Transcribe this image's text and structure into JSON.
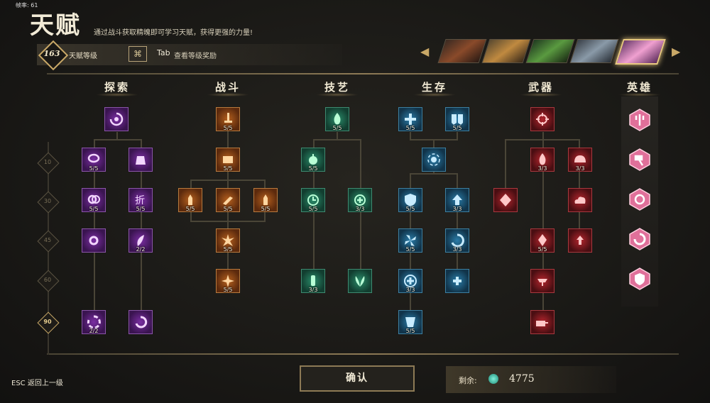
{
  "fps_label": "帧率: 61",
  "page": {
    "title": "天赋",
    "subtitle": "通过战斗获取精魄即可学习天赋，获得更强的力量!"
  },
  "header": {
    "level_value": "163",
    "level_label": "天赋等级",
    "tab_key": "Tab",
    "tab_label": "查看等级奖励"
  },
  "heroes": [
    "hero-1",
    "hero-2",
    "hero-3",
    "hero-4",
    "hero-5"
  ],
  "categories": [
    "探索",
    "战斗",
    "技艺",
    "生存",
    "武器",
    "英雄"
  ],
  "gates": [
    "10",
    "30",
    "45",
    "60",
    "90"
  ],
  "nodes": {
    "n_e2": "5/5",
    "n_e4": "5/5",
    "n_e5": "5/5",
    "n_e7": "2/2",
    "n_e8": "2/2",
    "n_c1": "5/5",
    "n_c2": "5/5",
    "n_c3": "5/5",
    "n_c4": "5/5",
    "n_c5": "5/5",
    "n_c6": "5/5",
    "n_c7": "5/5",
    "n_t1": "5/5",
    "n_t2": "5/5",
    "n_t3": "5/5",
    "n_t4": "3/3",
    "n_t5": "3/3",
    "n_t6": "",
    "n_s1": "5/5",
    "n_s2": "5/5",
    "n_s3": "",
    "n_s4": "5/5",
    "n_s5": "3/3",
    "n_s6": "5/5",
    "n_s7": "3/3",
    "n_s8": "3/3",
    "n_s10": "5/5",
    "n_w2": "3/3",
    "n_w3": "3/3",
    "n_w5": "5/5"
  },
  "footer": {
    "esc_label": "ESC  返回上一级",
    "confirm_label": "确认",
    "remain_label": "剩余:",
    "remain_value": "4775"
  },
  "colors": {
    "explore": "#7b2ea3",
    "combat": "#b5601e",
    "craft": "#2a8c6a",
    "survival": "#2a7ca8",
    "weapon": "#b3262e",
    "hero": "#e0709a",
    "accent_gold": "#c9a867"
  }
}
